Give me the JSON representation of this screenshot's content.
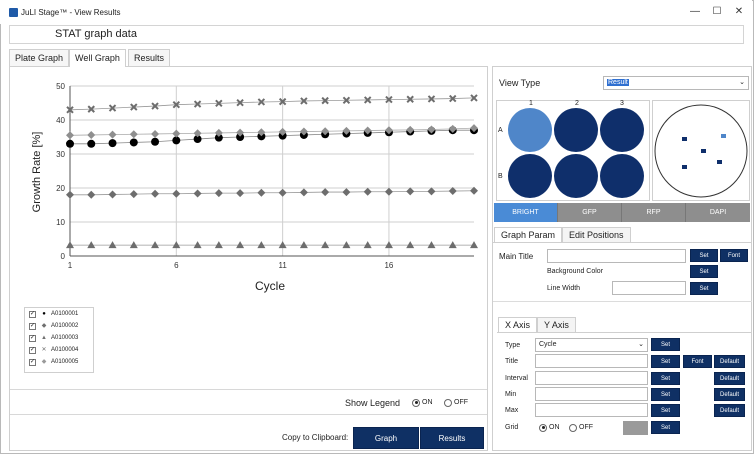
{
  "window": {
    "title": "JuLI Stage™ - View Results",
    "controls": {
      "minimize": "—",
      "maximize": "☐",
      "close": "✕"
    }
  },
  "section_title": "STAT graph data",
  "tabs": [
    {
      "label": "Plate Graph"
    },
    {
      "label": "Well Graph"
    },
    {
      "label": "Results"
    }
  ],
  "chart_data": {
    "type": "line",
    "ylabel": "Growth Rate [%]",
    "xlabel": "Cycle",
    "ylim": [
      0,
      50
    ],
    "xlim": [
      1,
      20
    ],
    "y_ticks": [
      "0",
      "10",
      "20",
      "30",
      "40",
      "50"
    ],
    "x_ticks": [
      "1",
      "6",
      "11",
      "16"
    ],
    "x_tick_values": [
      1,
      6,
      11,
      16
    ],
    "grid": true,
    "x": [
      1,
      2,
      3,
      4,
      5,
      6,
      7,
      8,
      9,
      10,
      11,
      12,
      13,
      14,
      15,
      16,
      17,
      18,
      19,
      20
    ],
    "series": [
      {
        "name": "A0100001",
        "marker": "circle",
        "values": [
          33,
          33,
          33.2,
          33.4,
          33.6,
          34,
          34.4,
          34.8,
          35,
          35.2,
          35.4,
          35.6,
          35.8,
          36,
          36.2,
          36.4,
          36.6,
          36.8,
          37,
          37
        ]
      },
      {
        "name": "A0100002",
        "marker": "diamond",
        "values": [
          18,
          18,
          18.1,
          18.2,
          18.3,
          18.3,
          18.4,
          18.5,
          18.5,
          18.6,
          18.6,
          18.7,
          18.8,
          18.8,
          18.9,
          18.9,
          19,
          19,
          19.1,
          19.2
        ]
      },
      {
        "name": "A0100003",
        "marker": "triangle",
        "values": [
          3.2,
          3.2,
          3.2,
          3.2,
          3.2,
          3.2,
          3.2,
          3.2,
          3.2,
          3.2,
          3.2,
          3.2,
          3.2,
          3.2,
          3.2,
          3.2,
          3.2,
          3.2,
          3.2,
          3.2
        ]
      },
      {
        "name": "A0100004",
        "marker": "x",
        "values": [
          43,
          43.2,
          43.5,
          43.8,
          44.1,
          44.5,
          44.7,
          44.9,
          45.1,
          45.3,
          45.4,
          45.6,
          45.7,
          45.8,
          45.9,
          46,
          46.1,
          46.2,
          46.3,
          46.5
        ]
      },
      {
        "name": "A0100005",
        "marker": "diamond-light",
        "values": [
          35.5,
          35.6,
          35.7,
          35.8,
          35.9,
          36,
          36.1,
          36.2,
          36.3,
          36.4,
          36.5,
          36.6,
          36.7,
          36.8,
          36.9,
          37,
          37.1,
          37.2,
          37.4,
          37.6
        ]
      }
    ]
  },
  "legend": {
    "items": [
      {
        "check": "✓",
        "marker": "●",
        "name": "A0100001"
      },
      {
        "check": "✓",
        "marker": "◆",
        "name": "A0100002"
      },
      {
        "check": "✓",
        "marker": "▲",
        "name": "A0100003"
      },
      {
        "check": "✓",
        "marker": "✕",
        "name": "A0100004"
      },
      {
        "check": "✓",
        "marker": "◆",
        "name": "A0100005"
      }
    ]
  },
  "show_legend": {
    "label": "Show Legend",
    "on": "ON",
    "off": "OFF",
    "selected": "ON"
  },
  "copy": {
    "label": "Copy to Clipboard:",
    "graph": "Graph",
    "results": "Results"
  },
  "view_type": {
    "label": "View Type",
    "value": "Result"
  },
  "plate": {
    "col_labels": [
      "1",
      "2",
      "3"
    ],
    "row_labels": [
      "A",
      "B"
    ],
    "selected_color": "#4f86c9",
    "well_color": "#0f2f6b"
  },
  "channels": [
    {
      "label": "BRIGHT",
      "active": true
    },
    {
      "label": "GFP",
      "active": false
    },
    {
      "label": "RFP",
      "active": false
    },
    {
      "label": "DAPI",
      "active": false
    }
  ],
  "graph_param_tabs": [
    {
      "label": "Graph Param"
    },
    {
      "label": "Edit Positions"
    }
  ],
  "graph_param": {
    "main_title": "Main Title",
    "background_color": "Background Color",
    "line_width": "Line Width",
    "set": "Set",
    "font": "Font"
  },
  "axis_tabs": [
    {
      "label": "X Axis"
    },
    {
      "label": "Y Axis"
    }
  ],
  "axis": {
    "type_label": "Type",
    "type_value": "Cycle",
    "title_label": "Title",
    "interval_label": "Interval",
    "min_label": "Min",
    "max_label": "Max",
    "grid_label": "Grid",
    "grid_on": "ON",
    "grid_off": "OFF",
    "set": "Set",
    "font": "Font",
    "default": "Default"
  }
}
